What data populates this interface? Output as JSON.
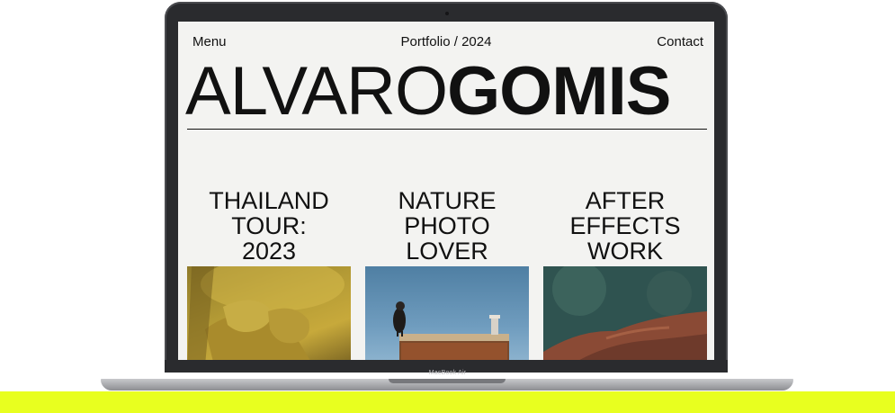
{
  "nav": {
    "menu": "Menu",
    "center": "Portfolio / 2024",
    "contact": "Contact"
  },
  "hero": {
    "first": "ALVARO",
    "last": "GOMIS"
  },
  "projects": [
    {
      "title_lines": [
        "THAILAND",
        "TOUR:",
        "2023"
      ],
      "image": "golden-buddha-hand"
    },
    {
      "title_lines": [
        "NATURE",
        "PHOTO",
        "LOVER"
      ],
      "image": "bird-on-rusty-sign"
    },
    {
      "title_lines": [
        "AFTER",
        "EFFECTS",
        "WORK"
      ],
      "image": "landscape-teal-rust"
    }
  ],
  "device": {
    "label": "MacBook Air"
  },
  "colors": {
    "accent_band": "#e8ff1f",
    "screen_bg": "#f3f3f1",
    "text": "#111111"
  }
}
